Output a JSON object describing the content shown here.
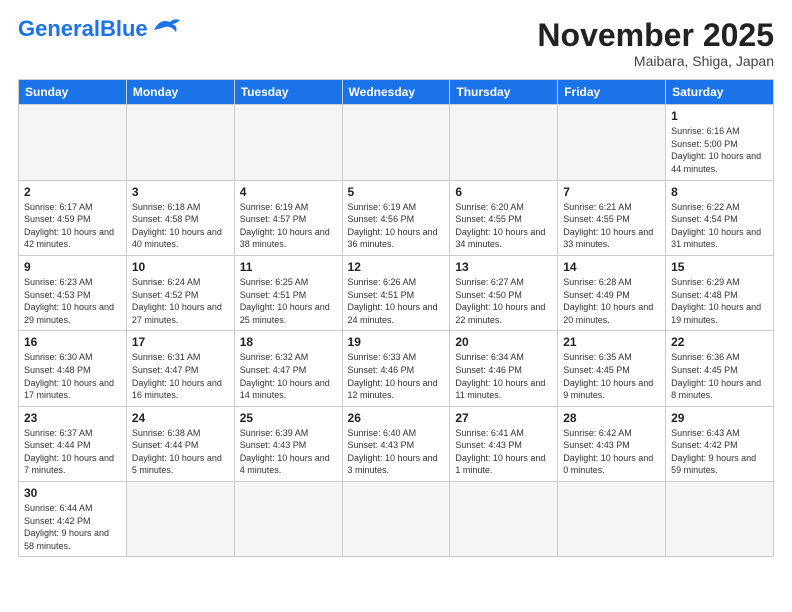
{
  "logo": {
    "text_general": "General",
    "text_blue": "Blue"
  },
  "header": {
    "month": "November 2025",
    "location": "Maibara, Shiga, Japan"
  },
  "days_of_week": [
    "Sunday",
    "Monday",
    "Tuesday",
    "Wednesday",
    "Thursday",
    "Friday",
    "Saturday"
  ],
  "weeks": [
    [
      {
        "day": "",
        "info": ""
      },
      {
        "day": "",
        "info": ""
      },
      {
        "day": "",
        "info": ""
      },
      {
        "day": "",
        "info": ""
      },
      {
        "day": "",
        "info": ""
      },
      {
        "day": "",
        "info": ""
      },
      {
        "day": "1",
        "info": "Sunrise: 6:16 AM\nSunset: 5:00 PM\nDaylight: 10 hours and 44 minutes."
      }
    ],
    [
      {
        "day": "2",
        "info": "Sunrise: 6:17 AM\nSunset: 4:59 PM\nDaylight: 10 hours and 42 minutes."
      },
      {
        "day": "3",
        "info": "Sunrise: 6:18 AM\nSunset: 4:58 PM\nDaylight: 10 hours and 40 minutes."
      },
      {
        "day": "4",
        "info": "Sunrise: 6:19 AM\nSunset: 4:57 PM\nDaylight: 10 hours and 38 minutes."
      },
      {
        "day": "5",
        "info": "Sunrise: 6:19 AM\nSunset: 4:56 PM\nDaylight: 10 hours and 36 minutes."
      },
      {
        "day": "6",
        "info": "Sunrise: 6:20 AM\nSunset: 4:55 PM\nDaylight: 10 hours and 34 minutes."
      },
      {
        "day": "7",
        "info": "Sunrise: 6:21 AM\nSunset: 4:55 PM\nDaylight: 10 hours and 33 minutes."
      },
      {
        "day": "8",
        "info": "Sunrise: 6:22 AM\nSunset: 4:54 PM\nDaylight: 10 hours and 31 minutes."
      }
    ],
    [
      {
        "day": "9",
        "info": "Sunrise: 6:23 AM\nSunset: 4:53 PM\nDaylight: 10 hours and 29 minutes."
      },
      {
        "day": "10",
        "info": "Sunrise: 6:24 AM\nSunset: 4:52 PM\nDaylight: 10 hours and 27 minutes."
      },
      {
        "day": "11",
        "info": "Sunrise: 6:25 AM\nSunset: 4:51 PM\nDaylight: 10 hours and 25 minutes."
      },
      {
        "day": "12",
        "info": "Sunrise: 6:26 AM\nSunset: 4:51 PM\nDaylight: 10 hours and 24 minutes."
      },
      {
        "day": "13",
        "info": "Sunrise: 6:27 AM\nSunset: 4:50 PM\nDaylight: 10 hours and 22 minutes."
      },
      {
        "day": "14",
        "info": "Sunrise: 6:28 AM\nSunset: 4:49 PM\nDaylight: 10 hours and 20 minutes."
      },
      {
        "day": "15",
        "info": "Sunrise: 6:29 AM\nSunset: 4:48 PM\nDaylight: 10 hours and 19 minutes."
      }
    ],
    [
      {
        "day": "16",
        "info": "Sunrise: 6:30 AM\nSunset: 4:48 PM\nDaylight: 10 hours and 17 minutes."
      },
      {
        "day": "17",
        "info": "Sunrise: 6:31 AM\nSunset: 4:47 PM\nDaylight: 10 hours and 16 minutes."
      },
      {
        "day": "18",
        "info": "Sunrise: 6:32 AM\nSunset: 4:47 PM\nDaylight: 10 hours and 14 minutes."
      },
      {
        "day": "19",
        "info": "Sunrise: 6:33 AM\nSunset: 4:46 PM\nDaylight: 10 hours and 12 minutes."
      },
      {
        "day": "20",
        "info": "Sunrise: 6:34 AM\nSunset: 4:46 PM\nDaylight: 10 hours and 11 minutes."
      },
      {
        "day": "21",
        "info": "Sunrise: 6:35 AM\nSunset: 4:45 PM\nDaylight: 10 hours and 9 minutes."
      },
      {
        "day": "22",
        "info": "Sunrise: 6:36 AM\nSunset: 4:45 PM\nDaylight: 10 hours and 8 minutes."
      }
    ],
    [
      {
        "day": "23",
        "info": "Sunrise: 6:37 AM\nSunset: 4:44 PM\nDaylight: 10 hours and 7 minutes."
      },
      {
        "day": "24",
        "info": "Sunrise: 6:38 AM\nSunset: 4:44 PM\nDaylight: 10 hours and 5 minutes."
      },
      {
        "day": "25",
        "info": "Sunrise: 6:39 AM\nSunset: 4:43 PM\nDaylight: 10 hours and 4 minutes."
      },
      {
        "day": "26",
        "info": "Sunrise: 6:40 AM\nSunset: 4:43 PM\nDaylight: 10 hours and 3 minutes."
      },
      {
        "day": "27",
        "info": "Sunrise: 6:41 AM\nSunset: 4:43 PM\nDaylight: 10 hours and 1 minute."
      },
      {
        "day": "28",
        "info": "Sunrise: 6:42 AM\nSunset: 4:43 PM\nDaylight: 10 hours and 0 minutes."
      },
      {
        "day": "29",
        "info": "Sunrise: 6:43 AM\nSunset: 4:42 PM\nDaylight: 9 hours and 59 minutes."
      }
    ],
    [
      {
        "day": "30",
        "info": "Sunrise: 6:44 AM\nSunset: 4:42 PM\nDaylight: 9 hours and 58 minutes."
      },
      {
        "day": "",
        "info": ""
      },
      {
        "day": "",
        "info": ""
      },
      {
        "day": "",
        "info": ""
      },
      {
        "day": "",
        "info": ""
      },
      {
        "day": "",
        "info": ""
      },
      {
        "day": "",
        "info": ""
      }
    ]
  ]
}
